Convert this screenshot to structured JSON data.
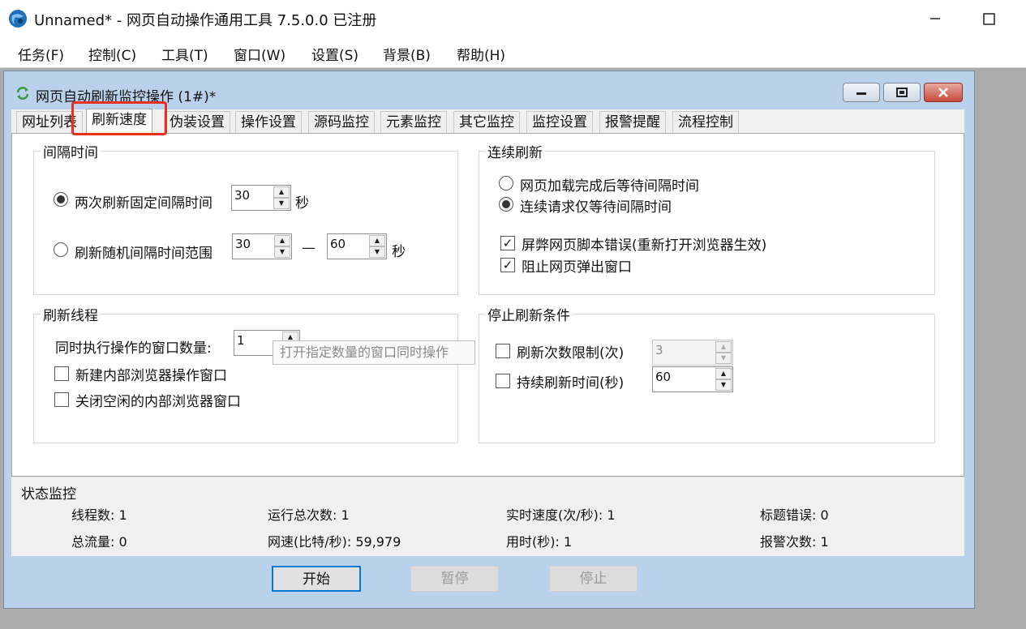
{
  "app": {
    "title": "Unnamed* - 网页自动操作通用工具 7.5.0.0  已注册"
  },
  "menu": [
    "任务(F)",
    "控制(C)",
    "工具(T)",
    "窗口(W)",
    "设置(S)",
    "背景(B)",
    "帮助(H)"
  ],
  "child": {
    "title": "网页自动刷新监控操作  (1#)*"
  },
  "tabs": [
    "网址列表",
    "刷新速度",
    "伪装设置",
    "操作设置",
    "源码监控",
    "元素监控",
    "其它监控",
    "监控设置",
    "报警提醒",
    "流程控制"
  ],
  "interval": {
    "legend": "间隔时间",
    "fixed_label": "两次刷新固定间隔时间",
    "fixed_value": "30",
    "fixed_unit": "秒",
    "random_label": "刷新随机间隔时间范围",
    "random_min": "30",
    "dash": "—",
    "random_max": "60",
    "random_unit": "秒"
  },
  "continuous": {
    "legend": "连续刷新",
    "opt1": "网页加载完成后等待间隔时间",
    "opt2": "连续请求仅等待间隔时间",
    "chk1": "屏弊网页脚本错误(重新打开浏览器生效)",
    "chk2": "阻止网页弹出窗口"
  },
  "threads": {
    "legend": "刷新线程",
    "count_label": "同时执行操作的窗口数量:",
    "count_value": "1",
    "tooltip": "打开指定数量的窗口同时操作",
    "chk1": "新建内部浏览器操作窗口",
    "chk2": "关闭空闲的内部浏览器窗口"
  },
  "stop": {
    "legend": "停止刷新条件",
    "count_label": "刷新次数限制(次)",
    "count_value": "3",
    "time_label": "持续刷新时间(秒)",
    "time_value": "60"
  },
  "status": {
    "legend": "状态监控",
    "threads": "线程数: 1",
    "total_runs": "运行总次数: 1",
    "speed": "实时速度(次/秒): 1",
    "title_errors": "标题错误: 0",
    "traffic": "总流量: 0",
    "net_speed": "网速(比特/秒): 59,979",
    "elapsed": "用时(秒): 1",
    "alarms": "报警次数: 1"
  },
  "buttons": {
    "start": "开始",
    "pause": "暂停",
    "stop": "停止"
  },
  "colors": {
    "highlight": "#e8311f",
    "focus": "#0078d7",
    "child_frame": "#b9d1ea"
  }
}
